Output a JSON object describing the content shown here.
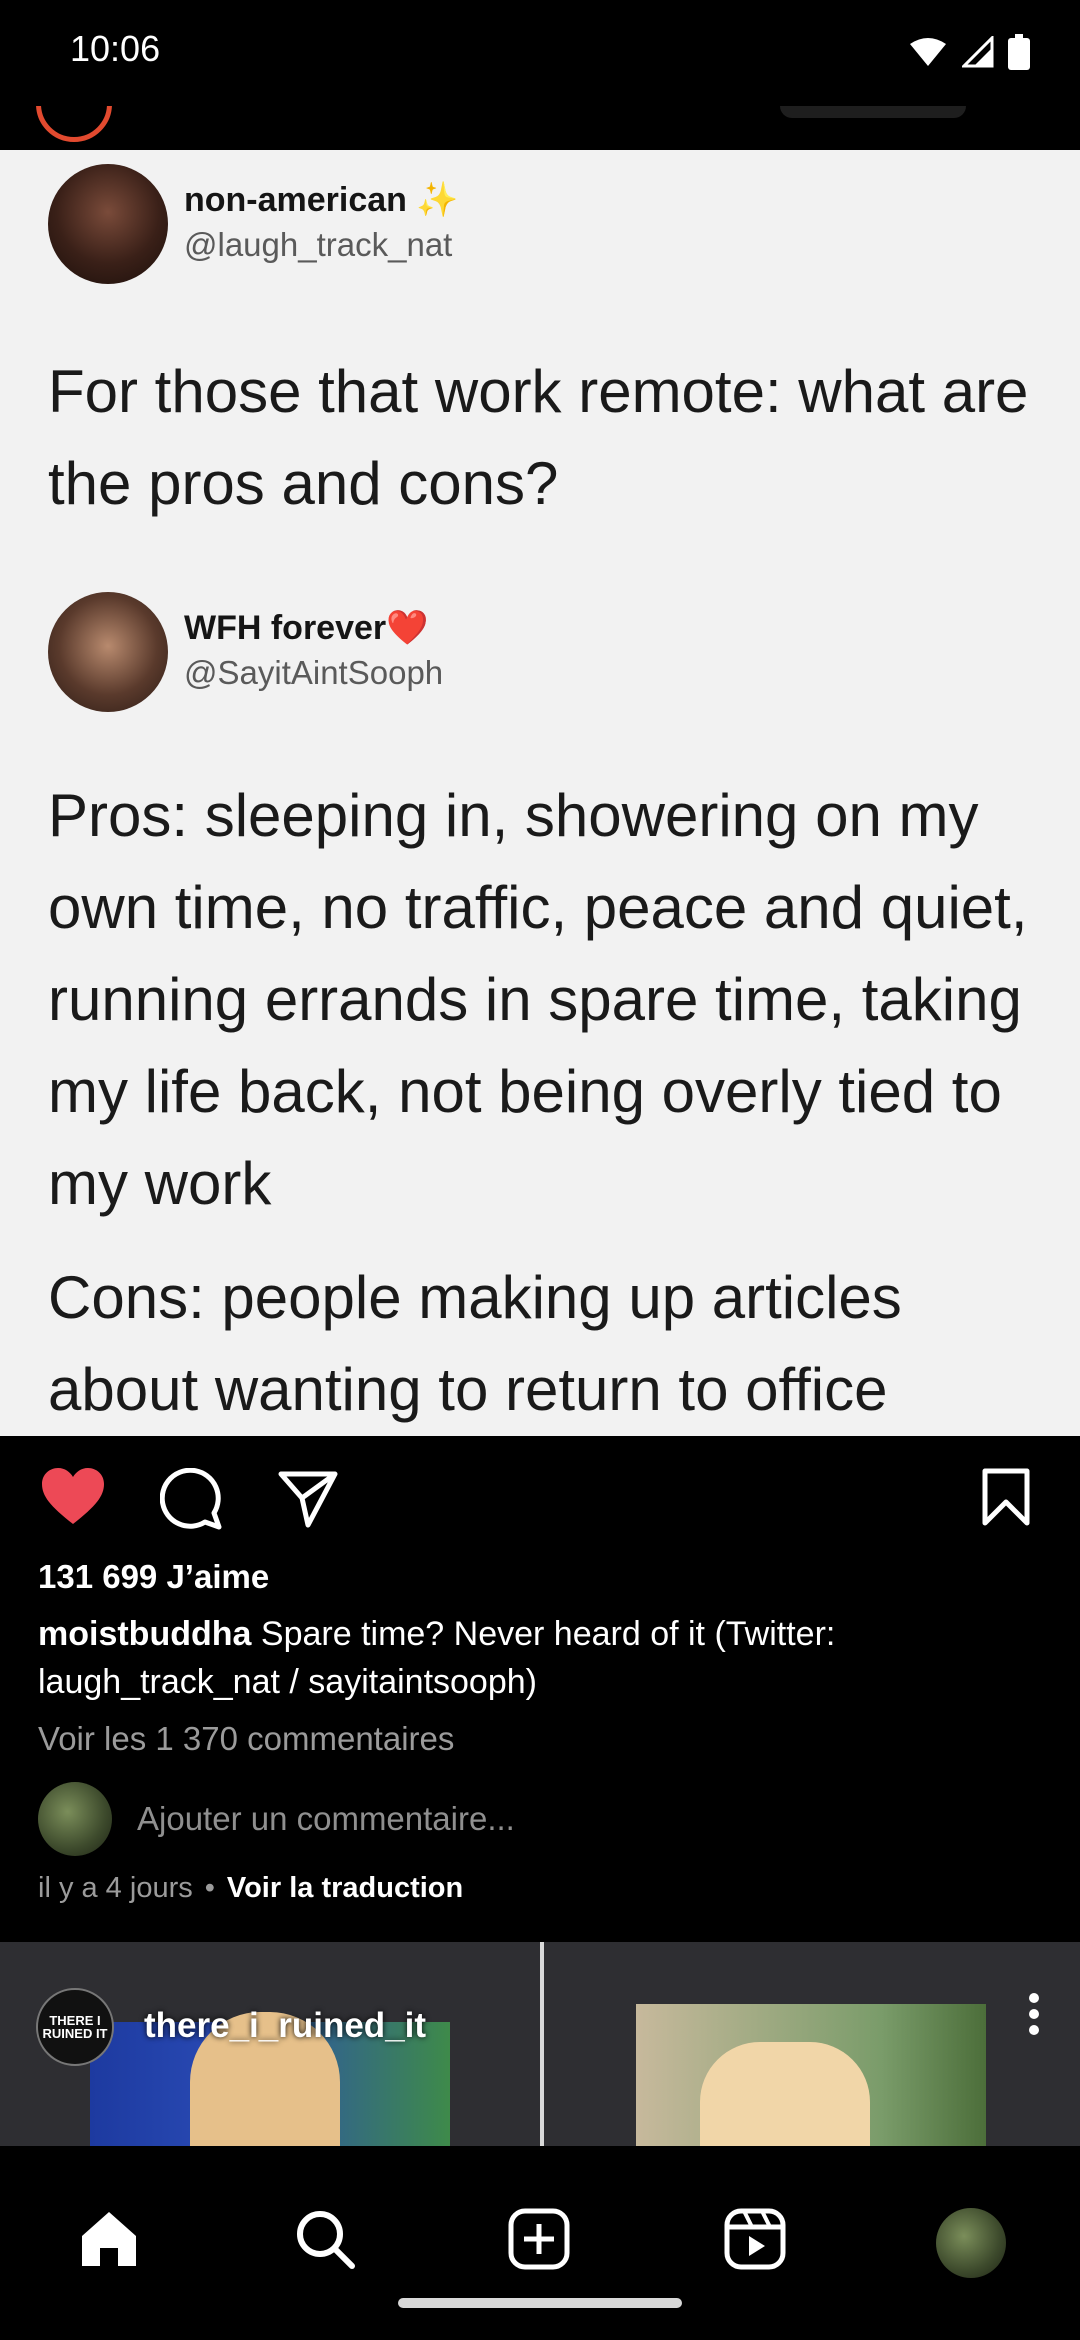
{
  "status_bar": {
    "time": "10:06"
  },
  "tweets": [
    {
      "name": "non-american",
      "name_emoji": "✨",
      "handle": "@laugh_track_nat",
      "text": "For those that work remote: what are the pros and cons?"
    },
    {
      "name": "WFH forever",
      "name_emoji": "❤️",
      "handle": "@SayitAintSooph",
      "text_pros": "Pros: sleeping in, showering on my own time, no traffic, peace and quiet, running errands in spare time, taking my life back, not being overly tied to my work",
      "text_cons": "Cons: people making up articles about wanting to return to office"
    }
  ],
  "post": {
    "likes": "131 699 J’aime",
    "author": "moistbuddha",
    "caption": "Spare time? Never heard of it (Twitter: laugh_track_nat / sayitaintsooph)",
    "view_comments": "Voir les 1 370 commentaires",
    "comment_placeholder": "Ajouter un commentaire...",
    "time_ago": "il y a 4 jours",
    "separator": "•",
    "translate": "Voir la traduction",
    "liked": true
  },
  "next_post": {
    "username": "there_i_ruined_it",
    "avatar_text": "THERE I RUINED IT"
  },
  "colors": {
    "like_red": "#ed4956",
    "background": "#000000",
    "muted_text": "#9b9b9b"
  },
  "icons": [
    "heart-icon",
    "comment-icon",
    "share-icon",
    "bookmark-icon",
    "home-icon",
    "search-icon",
    "create-icon",
    "reels-icon",
    "more-icon"
  ]
}
